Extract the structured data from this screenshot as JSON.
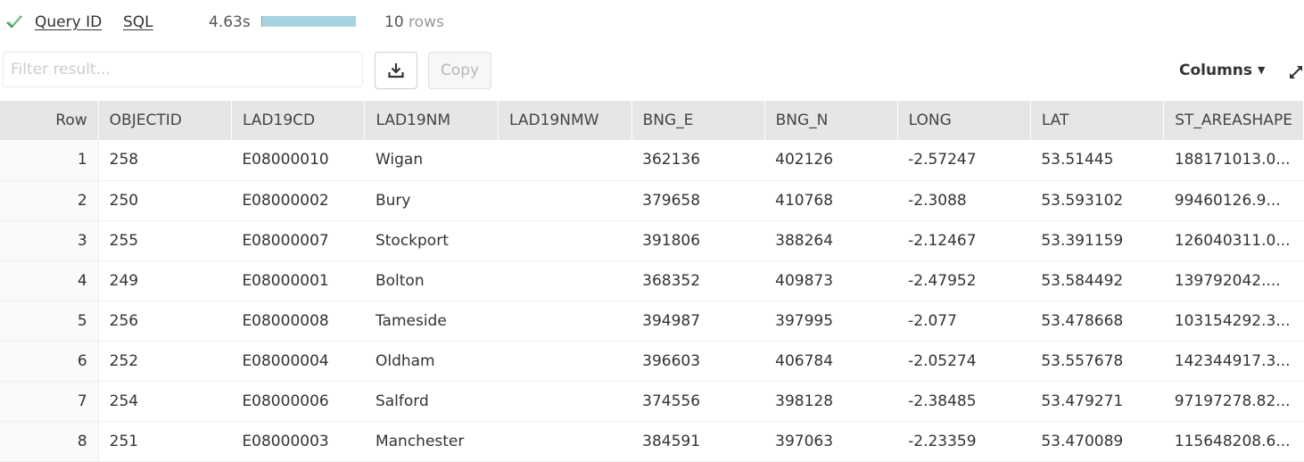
{
  "header": {
    "query_id_label": "Query ID",
    "sql_label": "SQL",
    "elapsed": "4.63s",
    "progress_fraction": 1.0,
    "rows_count": "10",
    "rows_label": "rows",
    "status_icon": "check-icon",
    "status_color": "#2e8b57"
  },
  "toolbar": {
    "filter_placeholder": "Filter result...",
    "filter_value": "",
    "download_icon": "download-icon",
    "copy_label": "Copy",
    "columns_label": "Columns",
    "columns_caret": "▼",
    "expand_icon": "expand-icon"
  },
  "table": {
    "row_header": "Row",
    "columns": [
      "OBJECTID",
      "LAD19CD",
      "LAD19NM",
      "LAD19NMW",
      "BNG_E",
      "BNG_N",
      "LONG",
      "LAT",
      "ST_AREASHAPE"
    ],
    "rows": [
      {
        "row": "1",
        "cells": [
          "258",
          "E08000010",
          "Wigan",
          "",
          "362136",
          "402126",
          "-2.57247",
          "53.51445",
          "188171013.0..."
        ]
      },
      {
        "row": "2",
        "cells": [
          "250",
          "E08000002",
          "Bury",
          "",
          "379658",
          "410768",
          "-2.3088",
          "53.593102",
          "99460126.9..."
        ]
      },
      {
        "row": "3",
        "cells": [
          "255",
          "E08000007",
          "Stockport",
          "",
          "391806",
          "388264",
          "-2.12467",
          "53.391159",
          "126040311.0..."
        ]
      },
      {
        "row": "4",
        "cells": [
          "249",
          "E08000001",
          "Bolton",
          "",
          "368352",
          "409873",
          "-2.47952",
          "53.584492",
          "139792042...."
        ]
      },
      {
        "row": "5",
        "cells": [
          "256",
          "E08000008",
          "Tameside",
          "",
          "394987",
          "397995",
          "-2.077",
          "53.478668",
          "103154292.3..."
        ]
      },
      {
        "row": "6",
        "cells": [
          "252",
          "E08000004",
          "Oldham",
          "",
          "396603",
          "406784",
          "-2.05274",
          "53.557678",
          "142344917.3..."
        ]
      },
      {
        "row": "7",
        "cells": [
          "254",
          "E08000006",
          "Salford",
          "",
          "374556",
          "398128",
          "-2.38485",
          "53.479271",
          "97197278.82..."
        ]
      },
      {
        "row": "8",
        "cells": [
          "251",
          "E08000003",
          "Manchester",
          "",
          "384591",
          "397063",
          "-2.23359",
          "53.470089",
          "115648208.6..."
        ]
      }
    ]
  }
}
